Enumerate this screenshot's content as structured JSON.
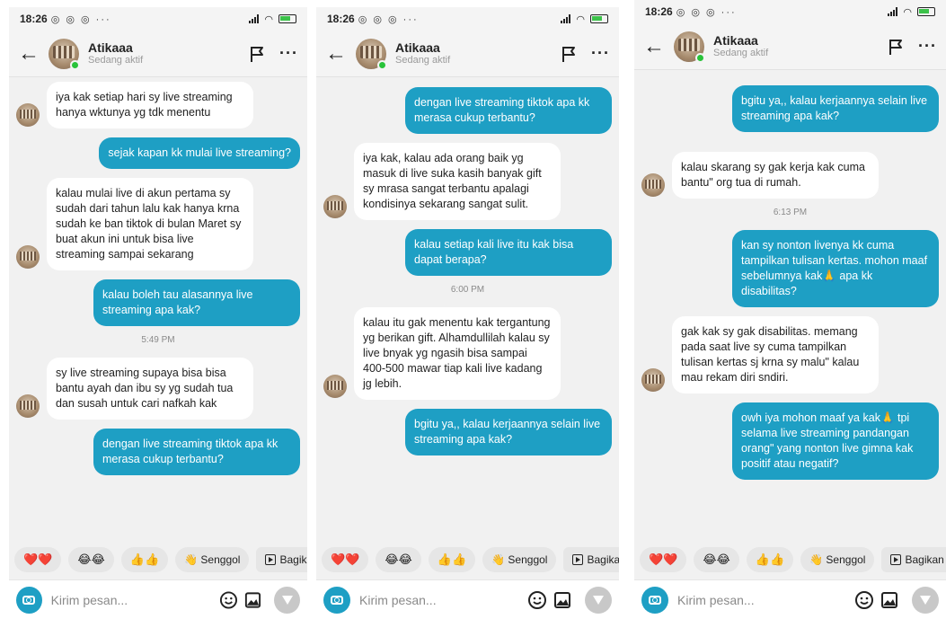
{
  "colors": {
    "outgoing_bubble": "#1e9fc4",
    "incoming_bubble": "#ffffff",
    "online": "#29c33a"
  },
  "icons": [
    "back-arrow-icon",
    "flag-icon",
    "more-icon",
    "camera-icon",
    "emoji-icon",
    "gallery-icon",
    "send-icon",
    "share-icon"
  ],
  "phones": [
    {
      "status_time": "18:26",
      "status_icons": "◎ ◎ ◎ ···",
      "contact_name": "Atikaaa",
      "contact_status": "Sedang aktif",
      "messages": [
        {
          "text": "iya kak setiap hari sy live streaming hanya wktunya yg tdk menentu"
        },
        {
          "text": "sejak kapan kk mulai live streaming?"
        },
        {
          "text": "kalau mulai live di akun pertama sy sudah dari tahun lalu kak hanya krna sudah ke ban tiktok di bulan Maret sy buat akun ini untuk bisa live streaming sampai sekarang"
        },
        {
          "text": "kalau boleh tau alasannya live streaming apa kak?"
        },
        {
          "timestamp": "5:49 PM"
        },
        {
          "text": "sy live streaming supaya bisa bisa bantu ayah dan ibu sy yg sudah tua dan susah untuk cari nafkah kak"
        },
        {
          "text": "dengan live streaming tiktok apa kk merasa cukup terbantu?"
        }
      ],
      "quick": [
        "❤️❤️",
        "😂😂",
        "👍👍",
        "👋 Senggol",
        "Bagikan"
      ],
      "input_placeholder": "Kirim pesan..."
    },
    {
      "status_time": "18:26",
      "status_icons": "◎ ◎ ◎ ···",
      "contact_name": "Atikaaa",
      "contact_status": "Sedang aktif",
      "messages": [
        {
          "text": "dengan live streaming tiktok apa kk merasa cukup terbantu?"
        },
        {
          "text": "iya kak, kalau ada orang baik yg masuk di live suka kasih banyak gift sy mrasa sangat terbantu apalagi kondisinya sekarang sangat sulit."
        },
        {
          "text": "kalau setiap kali live itu kak bisa dapat berapa?"
        },
        {
          "timestamp": "6:00 PM"
        },
        {
          "text": "kalau itu gak menentu kak tergantung yg berikan gift. Alhamdullilah kalau sy live bnyak yg ngasih bisa sampai 400-500 mawar tiap kali live kadang jg lebih."
        },
        {
          "text": "bgitu ya,, kalau kerjaannya selain live streaming apa kak?"
        }
      ],
      "quick": [
        "❤️❤️",
        "😂😂",
        "👍👍",
        "👋 Senggol",
        "Bagikan"
      ],
      "input_placeholder": "Kirim pesan..."
    },
    {
      "status_time": "18:26",
      "status_icons": "◎ ◎ ◎ ···",
      "contact_name": "Atikaaa",
      "contact_status": "Sedang aktif",
      "messages": [
        {
          "text": "bgitu ya,, kalau kerjaannya selain live streaming apa kak?"
        },
        {
          "text": "kalau skarang sy gak kerja kak cuma bantu\" org tua di rumah."
        },
        {
          "timestamp": "6:13 PM"
        },
        {
          "text": "kan sy nonton livenya kk cuma tampilkan tulisan kertas. mohon maaf sebelumnya kak🙏 apa kk disabilitas?"
        },
        {
          "text": "gak kak sy gak disabilitas. memang pada saat live sy cuma tampilkan tulisan kertas sj krna sy malu\" kalau mau rekam diri sndiri."
        },
        {
          "text": "owh iya mohon maaf ya kak🙏 tpi selama live streaming pandangan orang\" yang nonton live gimna kak positif atau negatif?"
        }
      ],
      "quick": [
        "❤️❤️",
        "😂😂",
        "👍👍",
        "👋 Senggol",
        "Bagikan"
      ],
      "input_placeholder": "Kirim pesan..."
    }
  ]
}
